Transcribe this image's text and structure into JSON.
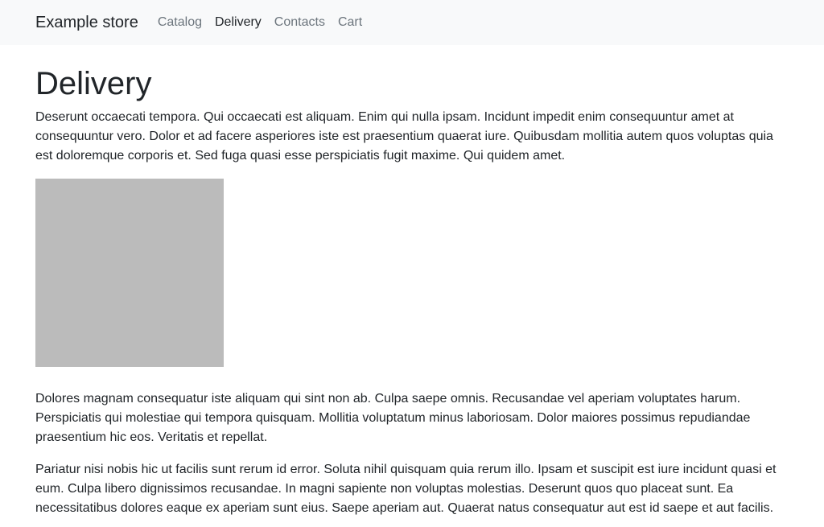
{
  "navbar": {
    "brand": "Example store",
    "links": [
      {
        "label": "Catalog",
        "active": false
      },
      {
        "label": "Delivery",
        "active": true
      },
      {
        "label": "Contacts",
        "active": false
      },
      {
        "label": "Cart",
        "active": false
      }
    ]
  },
  "main": {
    "title": "Delivery",
    "paragraphs": [
      "Deserunt occaecati tempora. Qui occaecati est aliquam. Enim qui nulla ipsam. Incidunt impedit enim consequuntur amet at consequuntur vero. Dolor et ad facere asperiores iste est praesentium quaerat iure. Quibusdam mollitia autem quos voluptas quia est doloremque corporis et. Sed fuga quasi esse perspiciatis fugit maxime. Qui quidem amet.",
      "Dolores magnam consequatur iste aliquam qui sint non ab. Culpa saepe omnis. Recusandae vel aperiam voluptates harum. Perspiciatis qui molestiae qui tempora quisquam. Mollitia voluptatum minus laboriosam. Dolor maiores possimus repudiandae praesentium hic eos. Veritatis et repellat.",
      "Pariatur nisi nobis hic ut facilis sunt rerum id error. Soluta nihil quisquam quia rerum illo. Ipsam et suscipit est iure incidunt quasi et eum. Culpa libero dignissimos recusandae. In magni sapiente non voluptas molestias. Deserunt quos quo placeat sunt. Ea necessitatibus dolores eaque ex aperiam sunt eius. Saepe aperiam aut. Quaerat natus consequatur aut est id saepe et aut facilis."
    ],
    "image_color": "#bbbbbb"
  }
}
